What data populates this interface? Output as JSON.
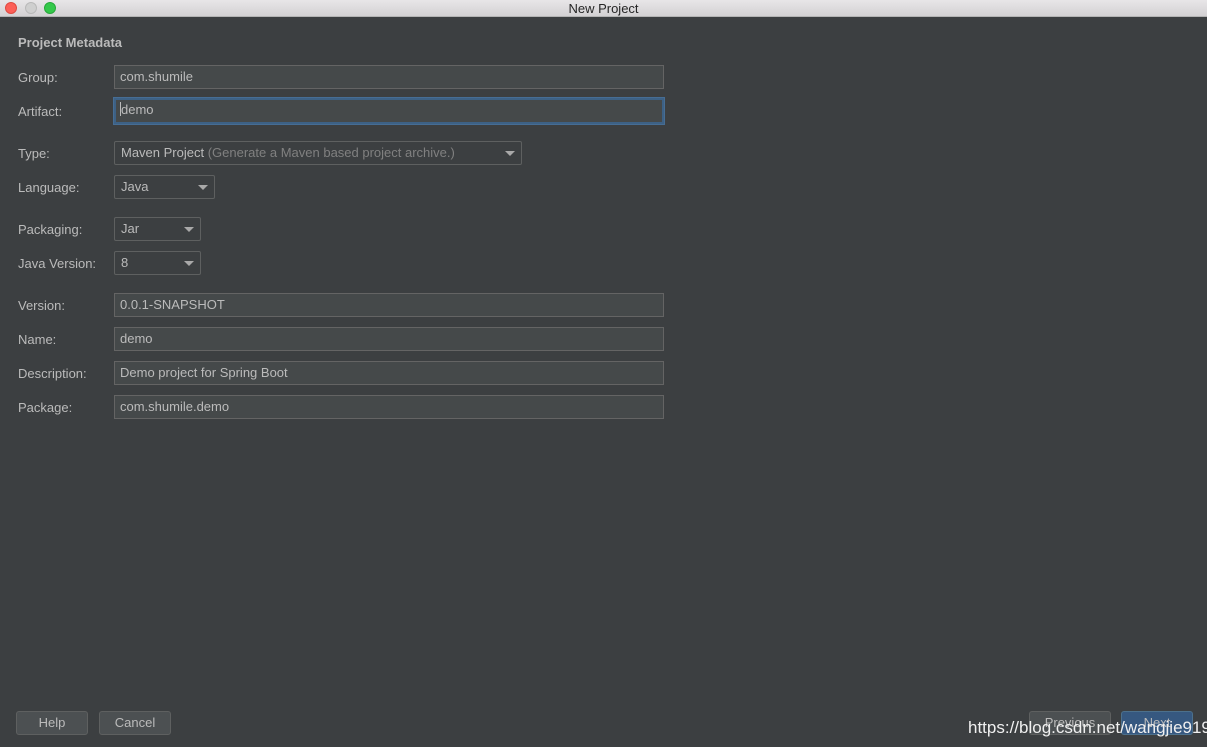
{
  "window": {
    "title": "New Project"
  },
  "form": {
    "section_title": "Project Metadata",
    "group": {
      "label": "Group:",
      "value": "com.shumile"
    },
    "artifact": {
      "label": "Artifact:",
      "value": "demo"
    },
    "type": {
      "label": "Type:",
      "value": "Maven Project",
      "hint": "(Generate a Maven based project archive.)"
    },
    "language": {
      "label": "Language:",
      "value": "Java"
    },
    "packaging": {
      "label": "Packaging:",
      "value": "Jar"
    },
    "java_version": {
      "label": "Java Version:",
      "value": "8"
    },
    "version": {
      "label": "Version:",
      "value": "0.0.1-SNAPSHOT"
    },
    "name": {
      "label": "Name:",
      "value": "demo"
    },
    "description": {
      "label": "Description:",
      "value": "Demo project for Spring Boot"
    },
    "package": {
      "label": "Package:",
      "value": "com.shumile.demo"
    }
  },
  "buttons": {
    "help": "Help",
    "cancel": "Cancel",
    "previous": "Previous",
    "next": "Next"
  },
  "watermark": "https://blog.csdn.net/wangjie919",
  "colors": {
    "background": "#3c3f41",
    "field_background": "#45494a",
    "focus_border": "#3d6185",
    "primary_button": "#365880"
  }
}
